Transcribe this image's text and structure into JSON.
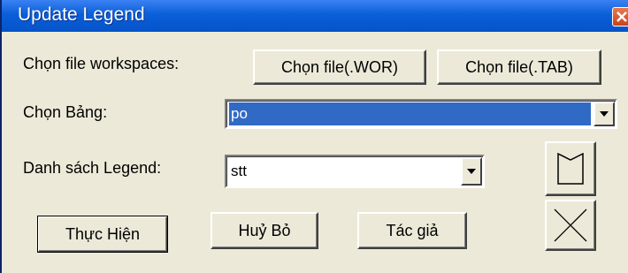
{
  "window": {
    "title": "Update Legend"
  },
  "workspace": {
    "label": "Chọn file workspaces:",
    "btn_wor": "Chọn file(.WOR)",
    "btn_tab": "Chọn file(.TAB)"
  },
  "table": {
    "label": "Chọn Bảng:",
    "value": "po"
  },
  "legend": {
    "label": "Danh sách Legend:",
    "value": "stt"
  },
  "actions": {
    "execute": "Thực Hiện",
    "cancel": "Huỷ Bỏ",
    "author": "Tác giả"
  },
  "icons": {
    "close": "close-icon",
    "banner": "banner-icon",
    "cross": "cross-icon"
  },
  "colors": {
    "titlebar": "#0553c9",
    "selection": "#316ac5",
    "face": "#ece9d8"
  }
}
